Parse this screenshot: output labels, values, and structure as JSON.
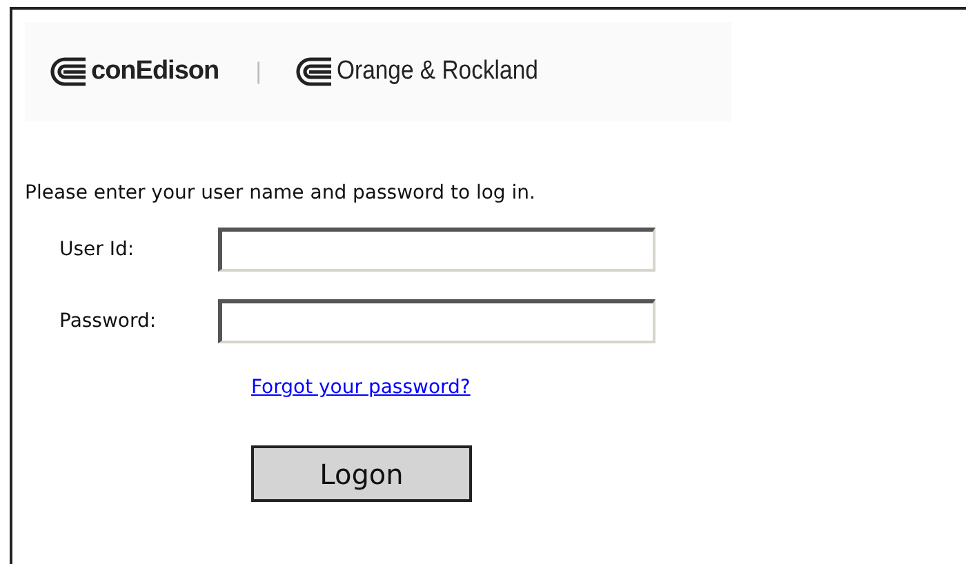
{
  "logos": [
    {
      "name": "conEdison"
    },
    {
      "name": "Orange & Rockland"
    }
  ],
  "separator": "|",
  "instruction": "Please enter your user name and password to log in.",
  "fields": [
    {
      "label": "User Id:"
    },
    {
      "label": "Password:"
    }
  ],
  "forgot_link": "Forgot your password?",
  "button": "Logon"
}
